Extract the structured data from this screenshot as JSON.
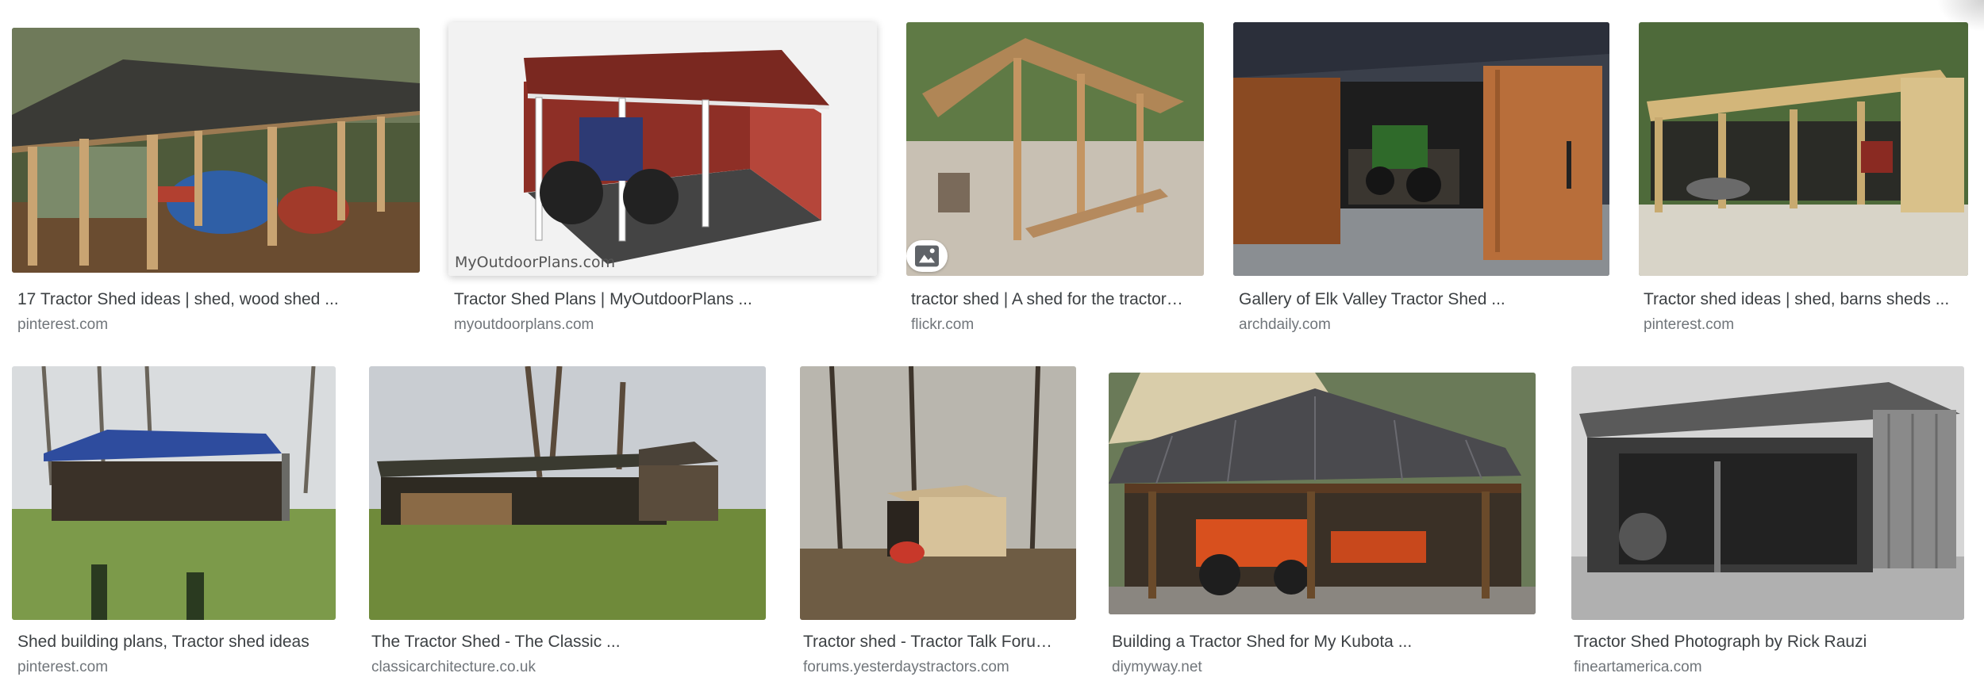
{
  "results": [
    {
      "title": "17 Tractor Shed ideas | shed, wood shed ...",
      "source": "pinterest.com"
    },
    {
      "title": "Tractor Shed Plans | MyOutdoorPlans ...",
      "source": "myoutdoorplans.com",
      "watermark": "MyOutdoorPlans.com"
    },
    {
      "title": "tractor shed | A shed for the tractor…",
      "source": "flickr.com",
      "badge_icon": "image-icon"
    },
    {
      "title": "Gallery of Elk Valley Tractor Shed ...",
      "source": "archdaily.com"
    },
    {
      "title": "Tractor shed ideas | shed, barns sheds ...",
      "source": "pinterest.com"
    },
    {
      "title": "Shed building plans, Tractor shed ideas",
      "source": "pinterest.com"
    },
    {
      "title": "The Tractor Shed - The Classic ...",
      "source": "classicarchitecture.co.uk"
    },
    {
      "title": "Tractor shed - Tractor Talk Foru…",
      "source": "forums.yesterdaystractors.com"
    },
    {
      "title": "Building a Tractor Shed for My Kubota ...",
      "source": "diymyway.net"
    },
    {
      "title": "Tractor Shed Photograph by Rick Rauzi",
      "source": "fineartamerica.com"
    }
  ]
}
